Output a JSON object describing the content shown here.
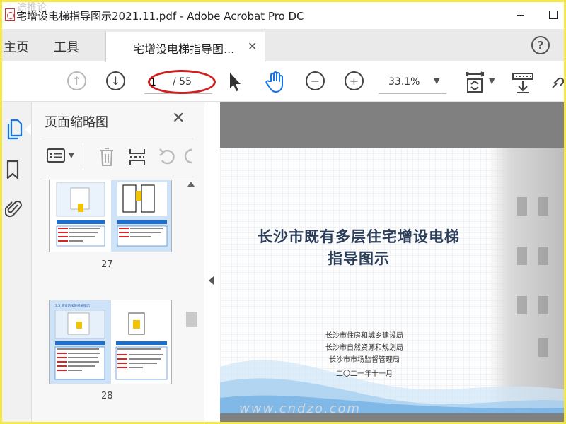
{
  "window": {
    "title": "宅增设电梯指导图示2021.11.pdf - Adobe Acrobat Pro DC",
    "top_watermark": "途推论"
  },
  "nav": {
    "home": "主页",
    "tools": "工具",
    "doc_tab": "宅增设电梯指导图...",
    "help": "?"
  },
  "toolbar": {
    "current_page": "1",
    "total_pages": "/ 55",
    "zoom": "33.1%"
  },
  "colors": {
    "accent_blue": "#1473e6",
    "highlight_red": "#d01f1f",
    "title_text": "#2c3e5a"
  },
  "thumbnails": {
    "panel_title": "页面缩略图",
    "pages": [
      {
        "number": "27"
      },
      {
        "number": "28",
        "heading": "3.5 增设后加装楼层图示"
      }
    ]
  },
  "document": {
    "title_line1": "长沙市既有多层住宅增设电梯",
    "title_line2": "指导图示",
    "issuers": [
      "长沙市住房和城乡建设局",
      "长沙市自然资源和规划局",
      "长沙市市场监督管理局"
    ],
    "date": "二〇二一年十一月"
  },
  "bottom_watermark": "www.cndzo.com"
}
